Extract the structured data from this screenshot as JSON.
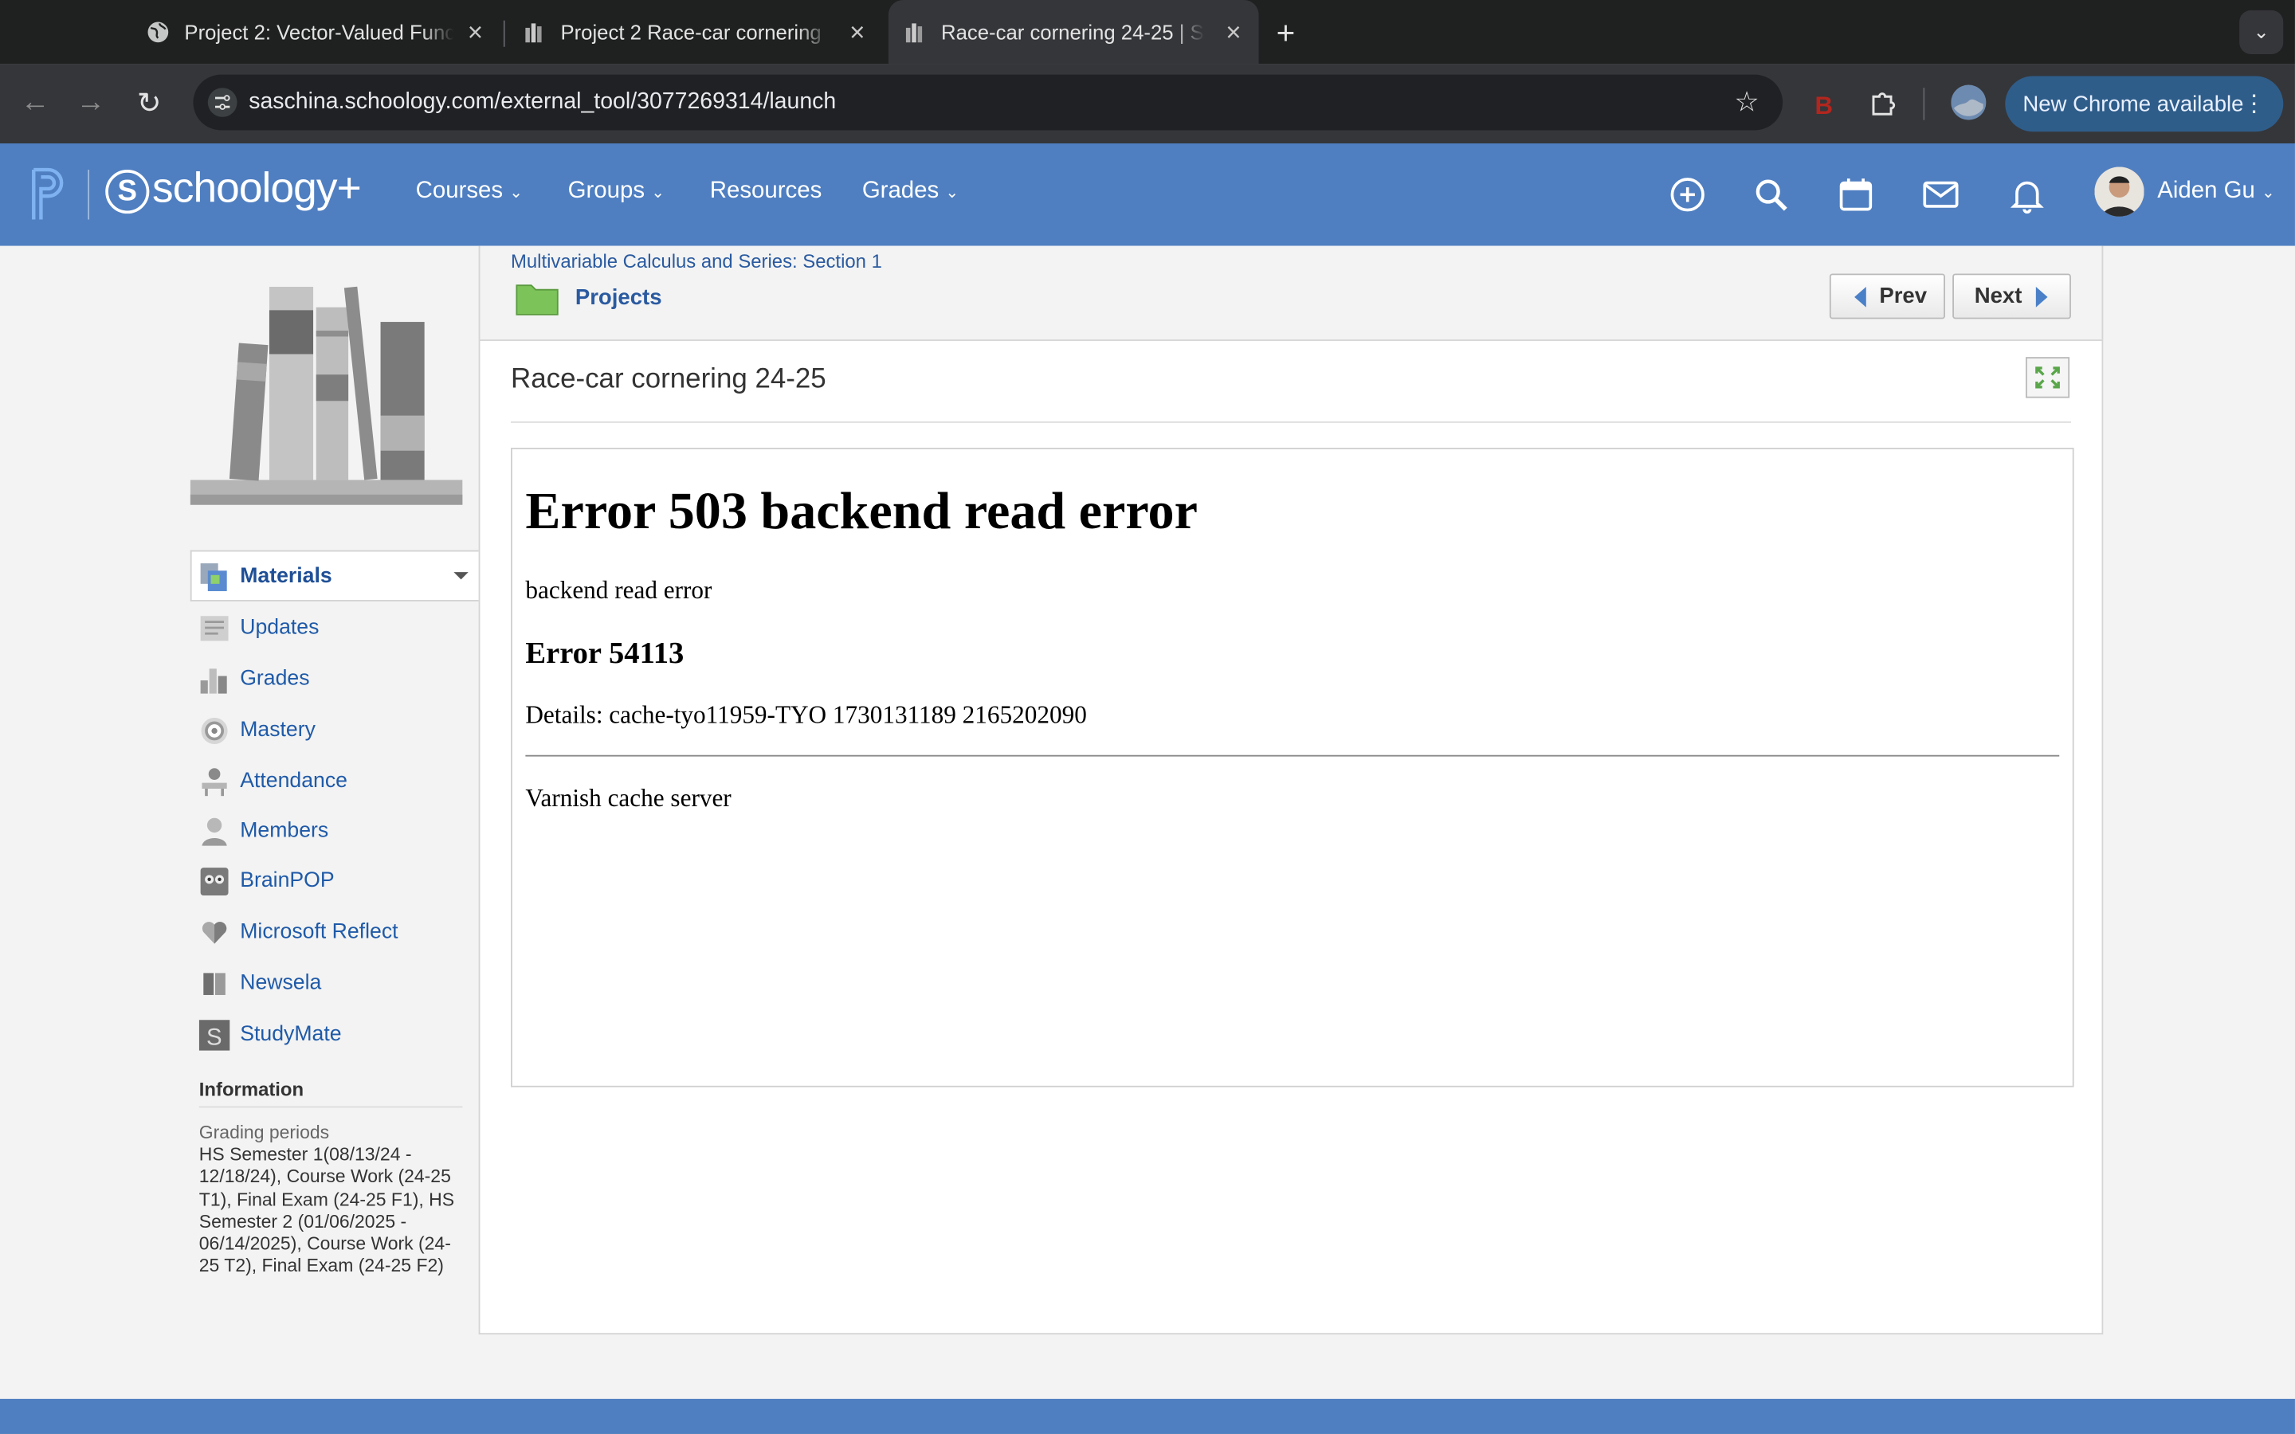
{
  "browser": {
    "tabs": [
      {
        "title": "Project 2: Vector-Valued Func",
        "icon": "globe-icon"
      },
      {
        "title": "Project 2 Race-car cornering",
        "icon": "schoology-course-icon"
      },
      {
        "title": "Race-car cornering 24-25 | Sc",
        "icon": "schoology-course-icon",
        "active": true
      }
    ],
    "url": "saschina.schoology.com/external_tool/3077269314/launch",
    "update_label": "New Chrome available"
  },
  "header": {
    "logo_text": "schoology+",
    "logo_s": "S",
    "nav": [
      {
        "label": "Courses",
        "dropdown": true
      },
      {
        "label": "Groups",
        "dropdown": true
      },
      {
        "label": "Resources",
        "dropdown": false
      },
      {
        "label": "Grades",
        "dropdown": true
      }
    ],
    "user_name": "Aiden Gu"
  },
  "sidebar": {
    "items": [
      {
        "label": "Materials",
        "icon": "materials-icon",
        "active": true
      },
      {
        "label": "Updates",
        "icon": "updates-icon"
      },
      {
        "label": "Grades",
        "icon": "grades-icon"
      },
      {
        "label": "Mastery",
        "icon": "mastery-icon"
      },
      {
        "label": "Attendance",
        "icon": "attendance-icon"
      },
      {
        "label": "Members",
        "icon": "members-icon"
      },
      {
        "label": "BrainPOP",
        "icon": "brainpop-icon"
      },
      {
        "label": "Microsoft Reflect",
        "icon": "reflect-icon"
      },
      {
        "label": "Newsela",
        "icon": "newsela-icon"
      },
      {
        "label": "StudyMate",
        "icon": "studymate-icon"
      }
    ],
    "info_title": "Information",
    "grading_label": "Grading periods",
    "grading_text": "HS Semester 1(08/13/24 - 12/18/24), Course Work (24-25 T1), Final Exam (24-25 F1), HS Semester 2 (01/06/2025 - 06/14/2025), Course Work (24-25 T2), Final Exam (24-25 F2)"
  },
  "main": {
    "breadcrumb_course": "Multivariable Calculus and Series: Section 1",
    "breadcrumb_folder": "Projects",
    "prev_label": "Prev",
    "next_label": "Next",
    "page_title": "Race-car cornering 24-25"
  },
  "error": {
    "heading": "Error 503 backend read error",
    "message": "backend read error",
    "code": "Error 54113",
    "details": "Details: cache-tyo11959-TYO 1730131189 2165202090",
    "server": "Varnish cache server"
  },
  "colors": {
    "header_blue": "#4f7fc1",
    "link_blue": "#1f5aa8",
    "tab_bg": "#1f2020",
    "toolbar_bg": "#35363a"
  }
}
